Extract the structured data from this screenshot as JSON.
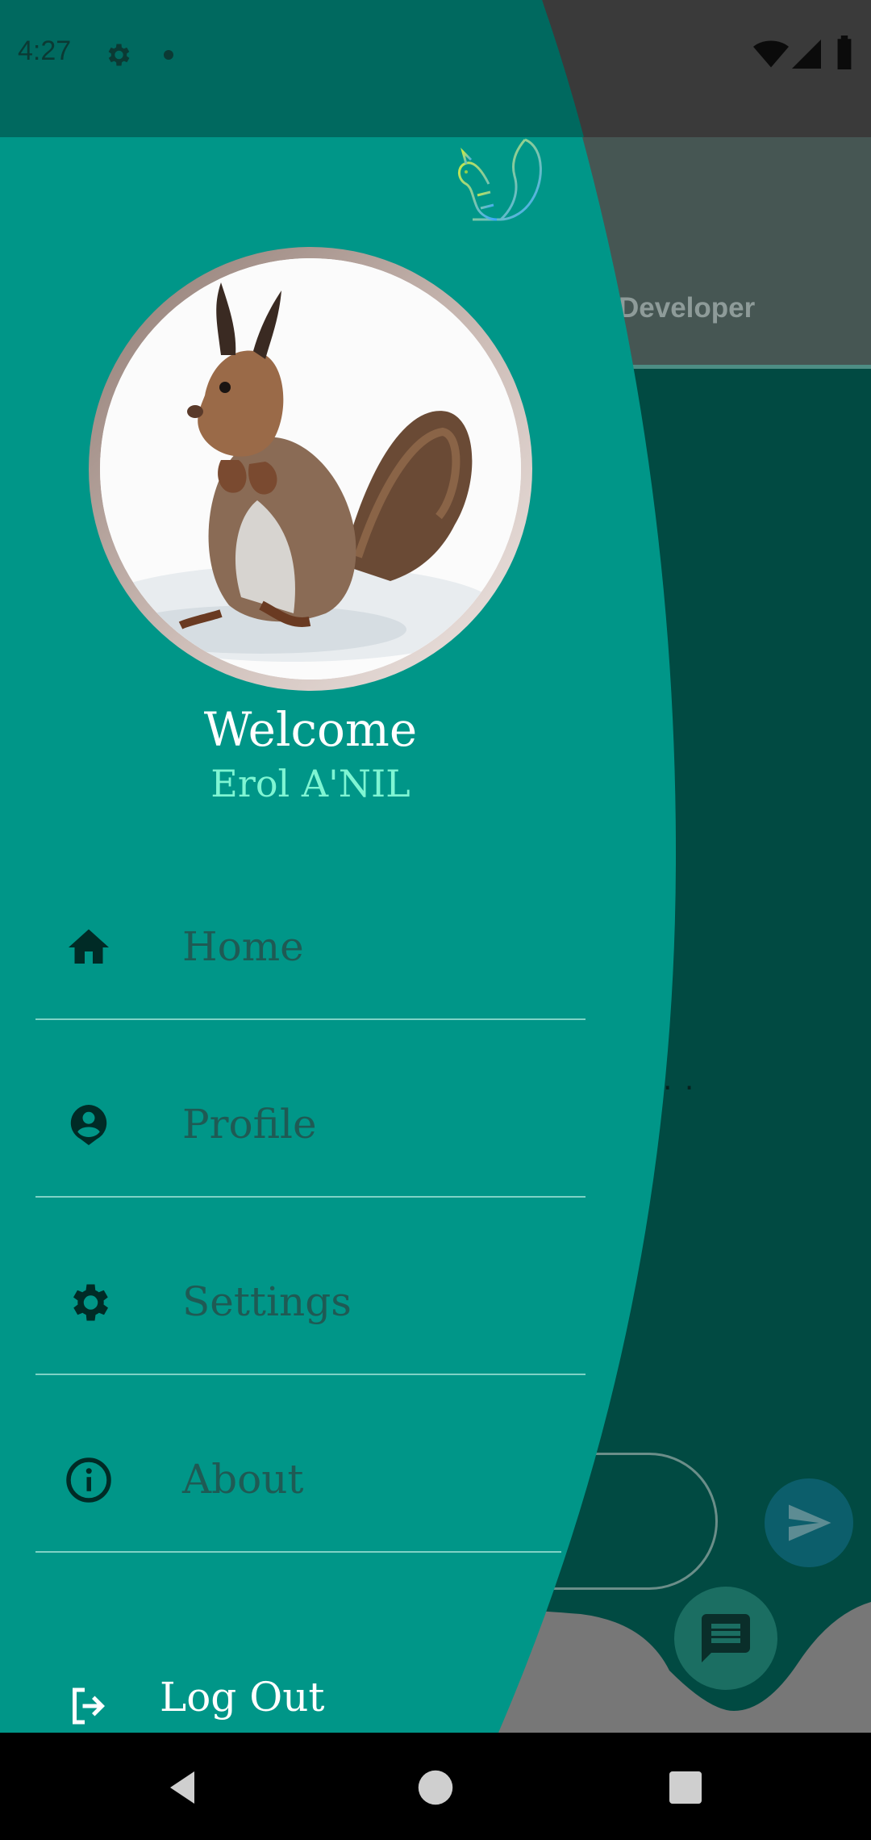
{
  "status_bar": {
    "time": "4:27"
  },
  "background_app": {
    "tab_label": "Developer",
    "typing_indicator": ". ."
  },
  "drawer": {
    "welcome": "Welcome",
    "user_name": "Erol A'NIL",
    "menu": [
      {
        "label": "Home",
        "icon": "home-icon"
      },
      {
        "label": "Profile",
        "icon": "profile-icon"
      },
      {
        "label": "Settings",
        "icon": "gear-icon"
      },
      {
        "label": "About",
        "icon": "info-icon"
      }
    ],
    "logout_label": "Log Out"
  },
  "colors": {
    "drawer": "#009688",
    "drawer_status": "#00695f",
    "username": "#7ff5d3"
  }
}
